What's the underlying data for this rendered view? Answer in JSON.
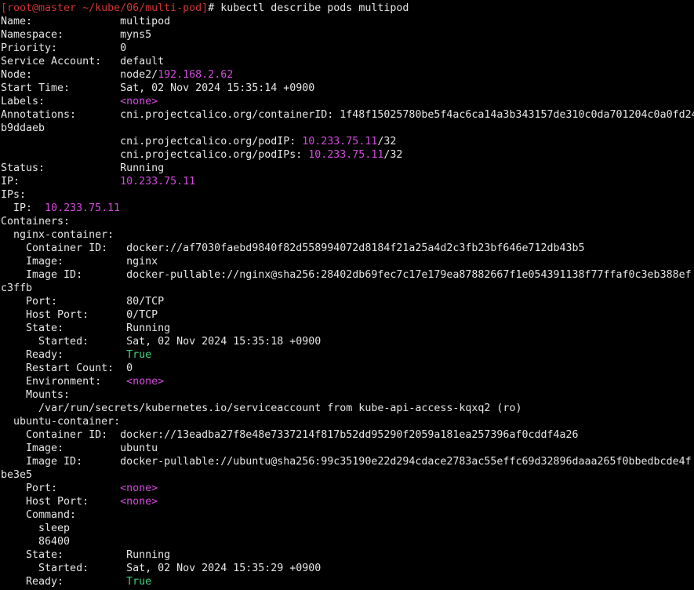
{
  "colors": {
    "background": "#000000",
    "foreground": "#e6e6e6",
    "prompt": "#cd3434",
    "highlight": "#d24bdc",
    "true_value": "#3cd27a"
  },
  "lines": [
    {
      "segs": [
        {
          "t": "[root@master ~/kube/06/multi-pod]",
          "c": "prompt"
        },
        {
          "t": "# kubectl describe pods multipod"
        }
      ]
    },
    {
      "segs": [
        {
          "t": "Name:              multipod"
        }
      ]
    },
    {
      "segs": [
        {
          "t": "Namespace:         myns5"
        }
      ]
    },
    {
      "segs": [
        {
          "t": "Priority:          0"
        }
      ]
    },
    {
      "segs": [
        {
          "t": "Service Account:   default"
        }
      ]
    },
    {
      "segs": [
        {
          "t": "Node:              node2/"
        },
        {
          "t": "192.168.2.62",
          "c": "mag"
        }
      ]
    },
    {
      "segs": [
        {
          "t": "Start Time:        Sat, 02 Nov 2024 15:35:14 +0900"
        }
      ]
    },
    {
      "segs": [
        {
          "t": "Labels:            "
        },
        {
          "t": "<none>",
          "c": "mag"
        }
      ]
    },
    {
      "segs": [
        {
          "t": "Annotations:       cni.projectcalico.org/containerID: 1f48f15025780be5f4ac6ca14a3b343157de310c0da701204c0a0fd24"
        }
      ]
    },
    {
      "segs": [
        {
          "t": "b9ddaeb"
        }
      ]
    },
    {
      "segs": [
        {
          "t": "                   cni.projectcalico.org/podIP: "
        },
        {
          "t": "10.233.75.11",
          "c": "mag"
        },
        {
          "t": "/32"
        }
      ]
    },
    {
      "segs": [
        {
          "t": "                   cni.projectcalico.org/podIPs: "
        },
        {
          "t": "10.233.75.11",
          "c": "mag"
        },
        {
          "t": "/32"
        }
      ]
    },
    {
      "segs": [
        {
          "t": "Status:            Running"
        }
      ]
    },
    {
      "segs": [
        {
          "t": "IP:                "
        },
        {
          "t": "10.233.75.11",
          "c": "mag"
        }
      ]
    },
    {
      "segs": [
        {
          "t": "IPs:"
        }
      ]
    },
    {
      "segs": [
        {
          "t": "  IP:  "
        },
        {
          "t": "10.233.75.11",
          "c": "mag"
        }
      ]
    },
    {
      "segs": [
        {
          "t": "Containers:"
        }
      ]
    },
    {
      "segs": [
        {
          "t": "  nginx-container:"
        }
      ]
    },
    {
      "segs": [
        {
          "t": "    Container ID:   docker://af7030faebd9840f82d558994072d8184f21a25a4d2c3fb23bf646e712db43b5"
        }
      ]
    },
    {
      "segs": [
        {
          "t": "    Image:          nginx"
        }
      ]
    },
    {
      "segs": [
        {
          "t": "    Image ID:       docker-pullable://nginx@sha256:28402db69fec7c17e179ea87882667f1e054391138f77ffaf0c3eb388ef"
        }
      ]
    },
    {
      "segs": [
        {
          "t": "c3ffb"
        }
      ]
    },
    {
      "segs": [
        {
          "t": "    Port:           80/TCP"
        }
      ]
    },
    {
      "segs": [
        {
          "t": "    Host Port:      0/TCP"
        }
      ]
    },
    {
      "segs": [
        {
          "t": "    State:          Running"
        }
      ]
    },
    {
      "segs": [
        {
          "t": "      Started:      Sat, 02 Nov 2024 15:35:18 +0900"
        }
      ]
    },
    {
      "segs": [
        {
          "t": "    Ready:          "
        },
        {
          "t": "True",
          "c": "green"
        }
      ]
    },
    {
      "segs": [
        {
          "t": "    Restart Count:  0"
        }
      ]
    },
    {
      "segs": [
        {
          "t": "    Environment:    "
        },
        {
          "t": "<none>",
          "c": "mag"
        }
      ]
    },
    {
      "segs": [
        {
          "t": "    Mounts:"
        }
      ]
    },
    {
      "segs": [
        {
          "t": "      /var/run/secrets/kubernetes.io/serviceaccount from kube-api-access-kqxq2 (ro)"
        }
      ]
    },
    {
      "segs": [
        {
          "t": "  ubuntu-container:"
        }
      ]
    },
    {
      "segs": [
        {
          "t": "    Container ID:  docker://13eadba27f8e48e7337214f817b52dd95290f2059a181ea257396af0cddf4a26"
        }
      ]
    },
    {
      "segs": [
        {
          "t": "    Image:         ubuntu"
        }
      ]
    },
    {
      "segs": [
        {
          "t": "    Image ID:      docker-pullable://ubuntu@sha256:99c35190e22d294cdace2783ac55effc69d32896daaa265f0bbedbcde4f"
        }
      ]
    },
    {
      "segs": [
        {
          "t": "be3e5"
        }
      ]
    },
    {
      "segs": [
        {
          "t": "    Port:          "
        },
        {
          "t": "<none>",
          "c": "mag"
        }
      ]
    },
    {
      "segs": [
        {
          "t": "    Host Port:     "
        },
        {
          "t": "<none>",
          "c": "mag"
        }
      ]
    },
    {
      "segs": [
        {
          "t": "    Command:"
        }
      ]
    },
    {
      "segs": [
        {
          "t": "      sleep"
        }
      ]
    },
    {
      "segs": [
        {
          "t": "      86400"
        }
      ]
    },
    {
      "segs": [
        {
          "t": "    State:          Running"
        }
      ]
    },
    {
      "segs": [
        {
          "t": "      Started:      Sat, 02 Nov 2024 15:35:29 +0900"
        }
      ]
    },
    {
      "segs": [
        {
          "t": "    Ready:          "
        },
        {
          "t": "True",
          "c": "green"
        }
      ]
    }
  ]
}
